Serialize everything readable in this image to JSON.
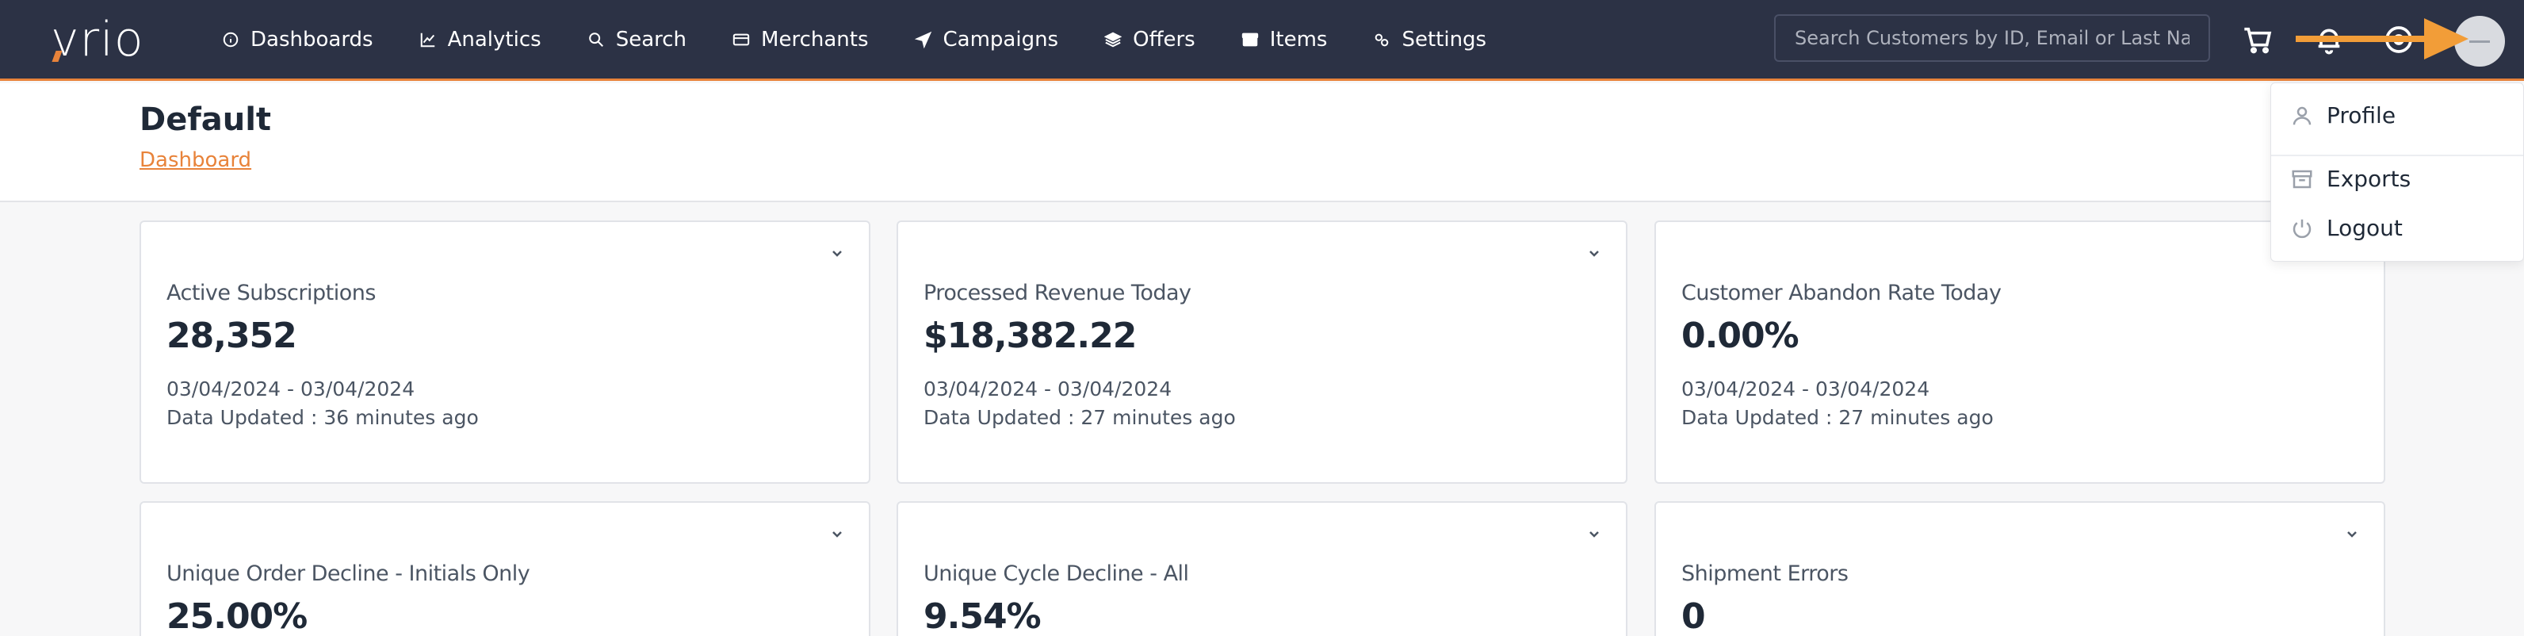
{
  "nav": {
    "logo": "vrio",
    "menu": [
      {
        "label": "Dashboards",
        "icon": "info-circle-icon"
      },
      {
        "label": "Analytics",
        "icon": "line-chart-icon"
      },
      {
        "label": "Search",
        "icon": "search-icon"
      },
      {
        "label": "Merchants",
        "icon": "credit-card-icon"
      },
      {
        "label": "Campaigns",
        "icon": "send-icon"
      },
      {
        "label": "Offers",
        "icon": "layers-icon"
      },
      {
        "label": "Items",
        "icon": "box-icon"
      },
      {
        "label": "Settings",
        "icon": "gears-icon"
      }
    ],
    "search_placeholder": "Search Customers by ID, Email or Last Name",
    "icons": [
      "cart-icon",
      "bell-icon",
      "help-circle-icon"
    ],
    "accent_color": "#e8833a",
    "bar_color": "#2c3245"
  },
  "header": {
    "title": "Default",
    "breadcrumb": "Dashboard"
  },
  "cards": [
    {
      "title": "Active Subscriptions",
      "value": "28,352",
      "range": "03/04/2024 - 03/04/2024",
      "updated": "Data Updated : 36 minutes ago"
    },
    {
      "title": "Processed Revenue Today",
      "value": "$18,382.22",
      "range": "03/04/2024 - 03/04/2024",
      "updated": "Data Updated : 27 minutes ago"
    },
    {
      "title": "Customer Abandon Rate Today",
      "value": "0.00%",
      "range": "03/04/2024 - 03/04/2024",
      "updated": "Data Updated : 27 minutes ago"
    },
    {
      "title": "Unique Order Decline - Initials Only",
      "value": "25.00%"
    },
    {
      "title": "Unique Cycle Decline - All",
      "value": "9.54%"
    },
    {
      "title": "Shipment Errors",
      "value": "0"
    }
  ],
  "profile_menu": {
    "items": [
      {
        "label": "Profile",
        "icon": "user-icon"
      },
      {
        "label": "Exports",
        "icon": "archive-icon"
      },
      {
        "label": "Logout",
        "icon": "power-icon"
      }
    ]
  },
  "annotation_color": "#f29d38"
}
